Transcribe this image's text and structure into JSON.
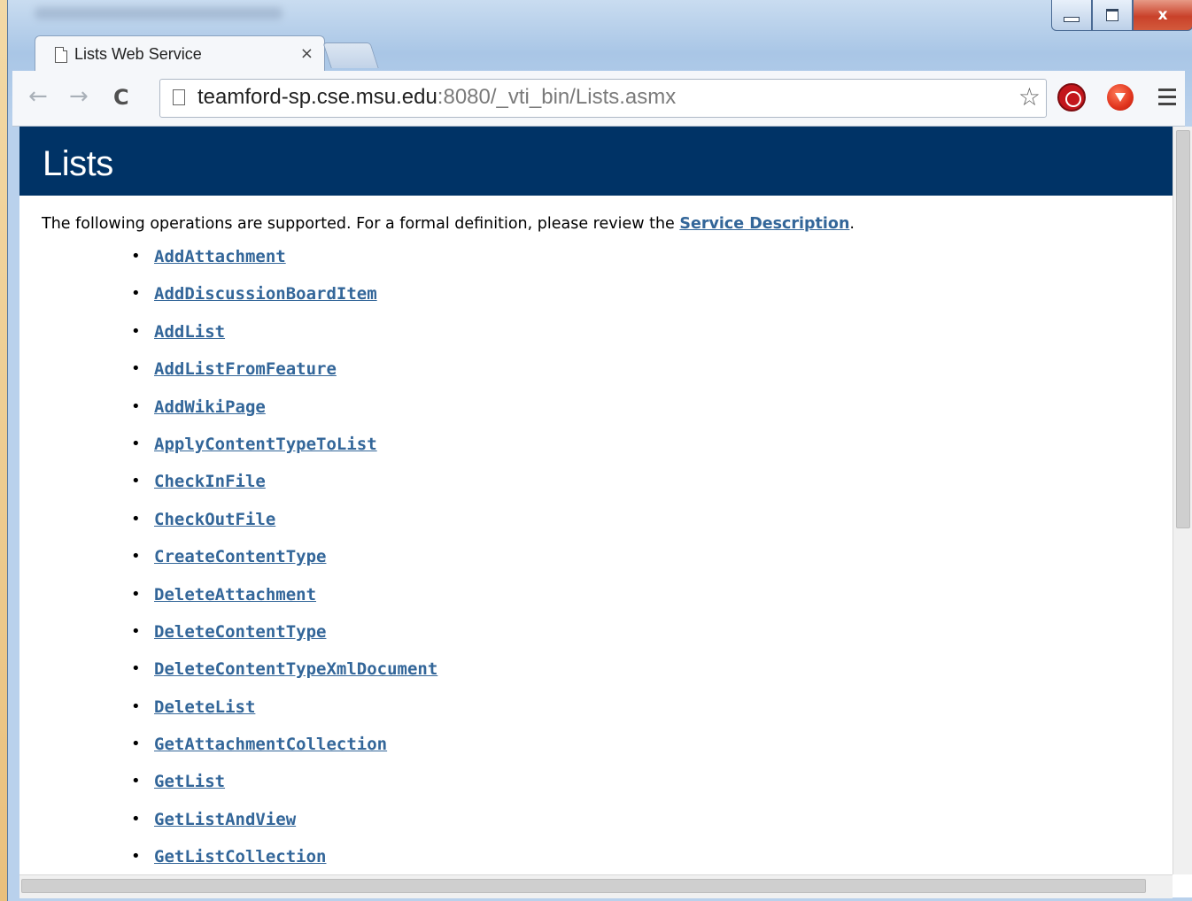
{
  "window": {
    "close_label": "x"
  },
  "tab": {
    "title": "Lists Web Service",
    "close_label": "×"
  },
  "toolbar": {
    "back_label": "←",
    "forward_label": "→",
    "reload_label": "C",
    "url_host": "teamford-sp.cse.msu.edu",
    "url_path": ":8080/_vti_bin/Lists.asmx",
    "bookmark_star": "☆"
  },
  "page": {
    "heading": "Lists",
    "intro_text": "The following operations are supported. For a formal definition, please review the ",
    "service_description_link": "Service Description",
    "intro_end": ".",
    "operations": [
      "AddAttachment",
      "AddDiscussionBoardItem",
      "AddList",
      "AddListFromFeature",
      "AddWikiPage",
      "ApplyContentTypeToList",
      "CheckInFile",
      "CheckOutFile",
      "CreateContentType",
      "DeleteAttachment",
      "DeleteContentType",
      "DeleteContentTypeXmlDocument",
      "DeleteList",
      "GetAttachmentCollection",
      "GetList",
      "GetListAndView",
      "GetListCollection"
    ]
  },
  "colors": {
    "header_bg": "#003366",
    "link": "#336699"
  }
}
